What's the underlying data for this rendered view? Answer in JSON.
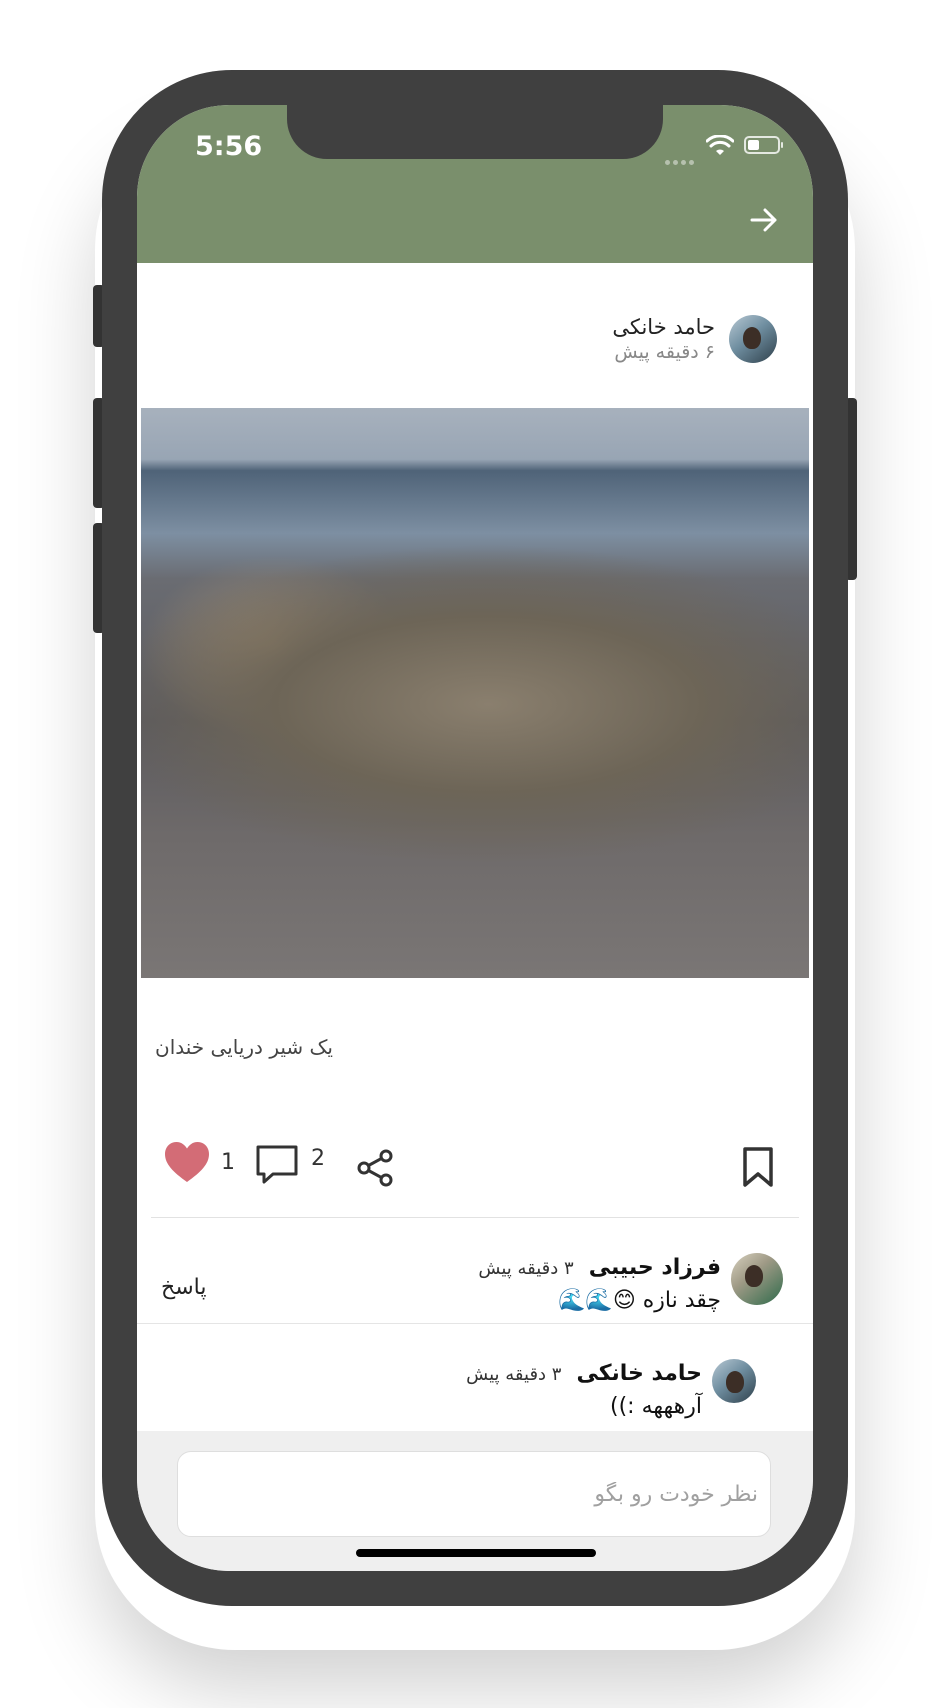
{
  "status_bar": {
    "time": "5:56"
  },
  "post": {
    "author_name": "حامد خانکی",
    "time_ago": "۶ دقیقه پیش",
    "caption": "یک شیر دریایی خندان",
    "like_count": "1",
    "comment_count": "2"
  },
  "comments": [
    {
      "author": "فرزاد حبیبی",
      "time_ago": "۳ دقیقه پیش",
      "text": "چقد نازه 😊🌊🌊",
      "reply_label": "پاسخ"
    },
    {
      "author": "حامد خانکی",
      "time_ago": "۳ دقیقه پیش",
      "text": "آرهههه :))"
    }
  ],
  "comment_input": {
    "placeholder": "نظر خودت رو بگو"
  },
  "colors": {
    "header": "#7a8f6c",
    "like": "#d36c76",
    "icons": "#333333"
  },
  "icons": {
    "back": "arrow-right-icon",
    "like": "heart-icon",
    "comment": "comment-icon",
    "share": "share-icon",
    "bookmark": "bookmark-icon"
  }
}
